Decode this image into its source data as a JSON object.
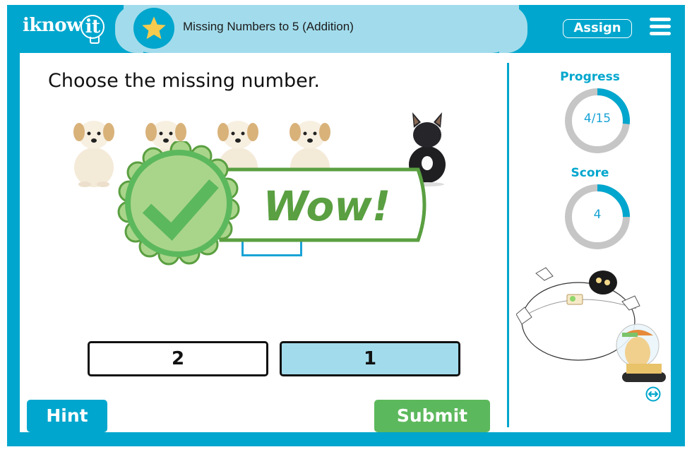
{
  "header": {
    "logo_text": "iknow",
    "logo_bulb_text": "it",
    "lesson_title": "Missing Numbers to 5 (Addition)",
    "star_icon": "star-icon",
    "assign_label": "Assign",
    "menu_icon": "hamburger-menu-icon"
  },
  "question": {
    "prompt": "Choose the missing number.",
    "images": [
      {
        "name": "puppy",
        "kind": "light"
      },
      {
        "name": "puppy",
        "kind": "light"
      },
      {
        "name": "puppy",
        "kind": "light"
      },
      {
        "name": "puppy",
        "kind": "light"
      },
      {
        "name": "french-bulldog",
        "kind": "dark"
      }
    ]
  },
  "feedback": {
    "text": "Wow!",
    "icon": "checkmark-badge-icon"
  },
  "answers": [
    {
      "label": "2",
      "selected": false
    },
    {
      "label": "1",
      "selected": true
    }
  ],
  "buttons": {
    "hint": "Hint",
    "submit": "Submit"
  },
  "sidebar": {
    "progress": {
      "label": "Progress",
      "text": "4/15",
      "fraction": 0.2667
    },
    "score": {
      "label": "Score",
      "text": "4",
      "fraction": 0.25
    },
    "mascot_icon": "robot-mascot-icon",
    "swap_icon": "swap-horizontal-icon"
  },
  "colors": {
    "brand": "#00a6cd",
    "title_bar": "#a2dcec",
    "success": "#5cb85c",
    "badge_light": "#a9d58a",
    "badge_dark": "#5a9f41",
    "ring_track": "#c6c6c6",
    "selected_answer": "#a2dcec"
  }
}
